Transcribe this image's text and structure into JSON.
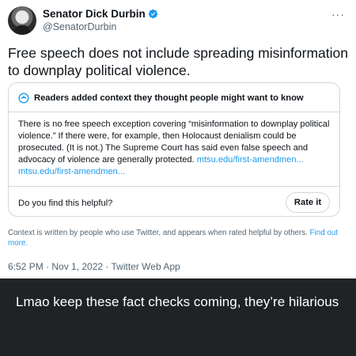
{
  "tweet": {
    "author_name": "Senator Dick Durbin",
    "author_handle": "@SenatorDurbin",
    "more_icon": "more-dots-icon",
    "text": "Free speech does not include spreading misinformation to downplay political violence.",
    "timestamp": "6:52 PM · Nov 1, 2022 · Twitter Web App"
  },
  "note": {
    "title": "Readers added context they thought people might want to know",
    "body": "There is no free speech exception covering “misinformation to downplay political violence.” If there were, for example, then Holocaust denialism could be prosecuted. (It is not.) The Supreme Court has said even false speech and advocacy of violence are generally protected.",
    "link1": "mtsu.edu/first-amendmen...",
    "link2": "mtsu.edu/first-amendmen...",
    "helpful_prompt": "Do you find this helpful?",
    "rate_label": "Rate it",
    "footnote": "Context is written by people who use Twitter, and appears when rated helpful by others.",
    "find_out_more": "Find out more."
  },
  "caption": {
    "text": "Lmao keep these fact checks coming, they’re hilarious"
  },
  "colors": {
    "accent": "#1d9bf0",
    "text": "#0f1419",
    "muted": "#536471",
    "border": "#cfd9de",
    "caption_bg": "#1f2326"
  }
}
